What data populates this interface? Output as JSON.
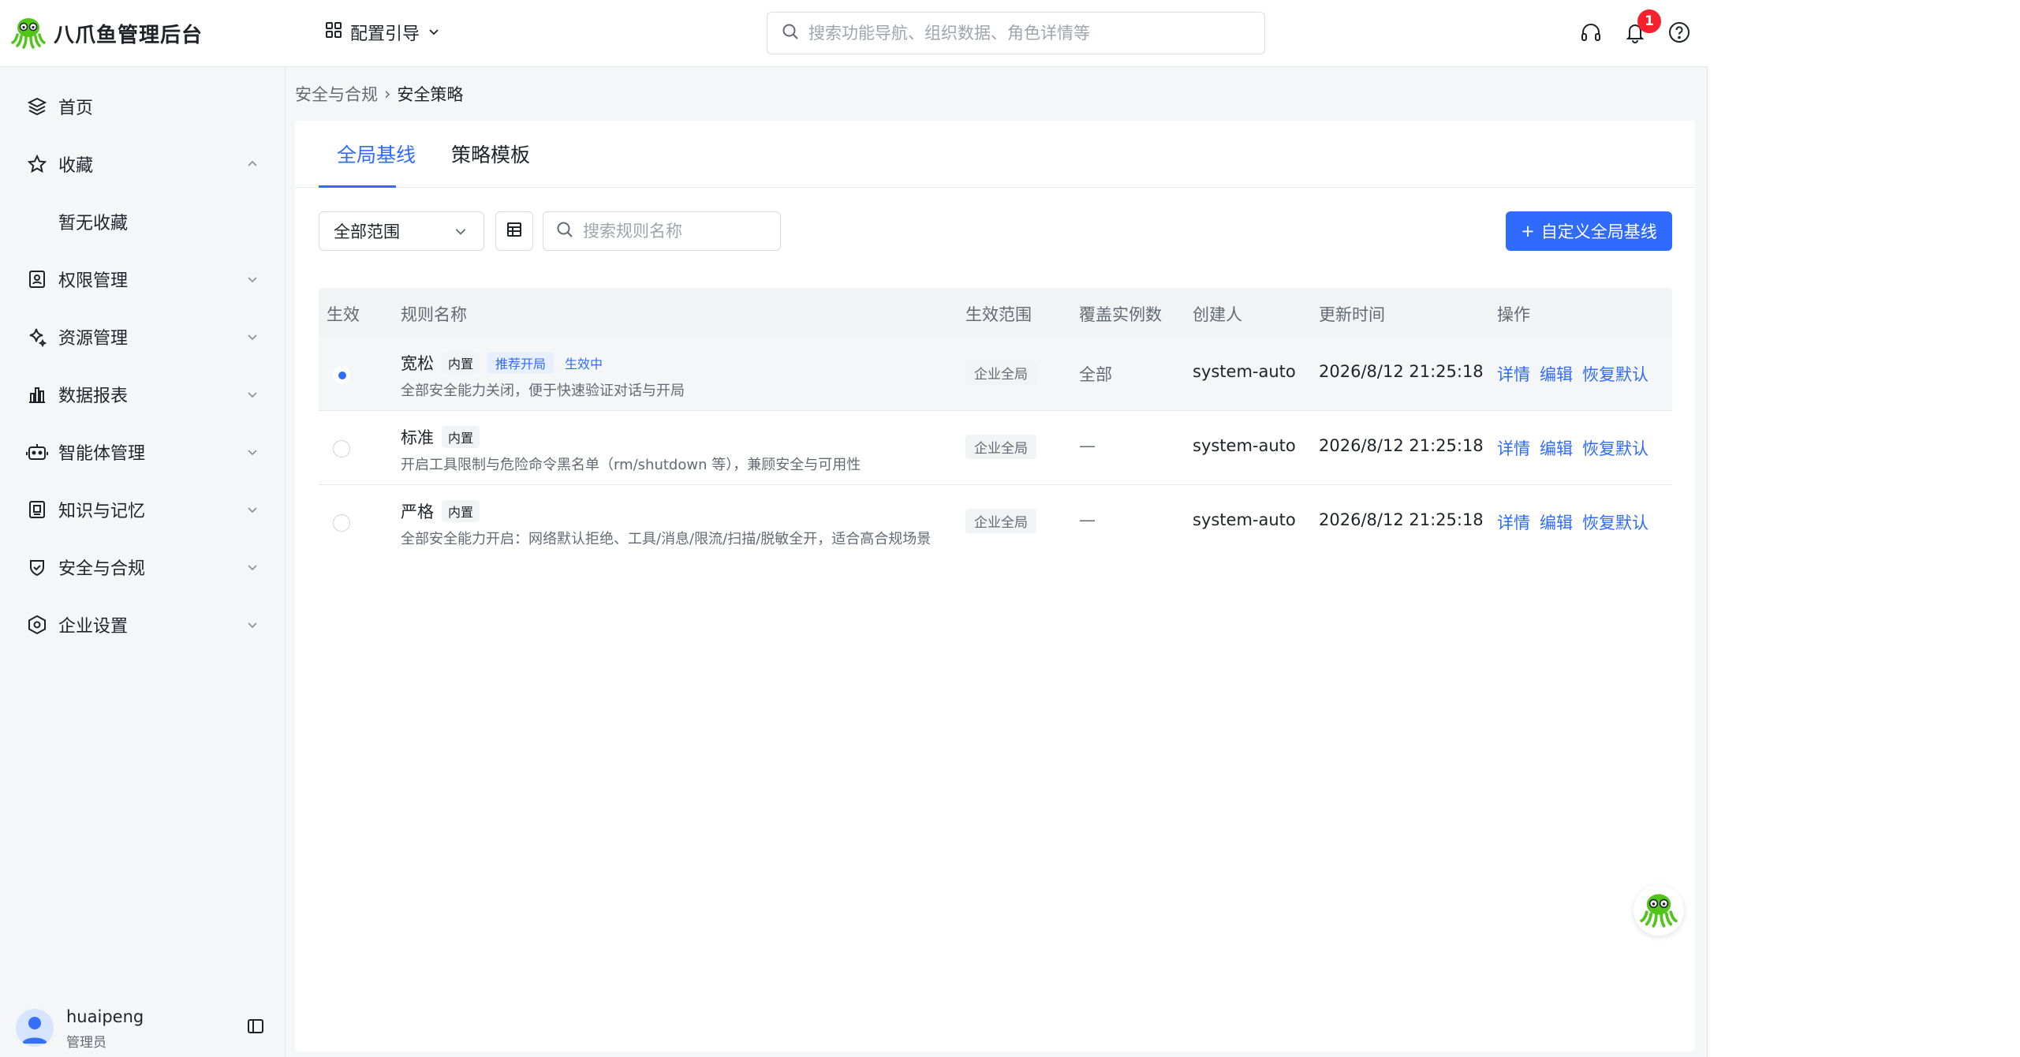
{
  "header": {
    "brand_name": "八爪鱼管理后台",
    "guide_label": "配置引导",
    "search_placeholder": "搜索功能导航、组织数据、角色详情等",
    "notification_count": "1"
  },
  "sidebar": {
    "items": [
      {
        "label": "首页",
        "icon": "layers-icon"
      },
      {
        "label": "收藏",
        "icon": "star-icon",
        "expanded": true,
        "sub": "暂无收藏"
      },
      {
        "label": "权限管理",
        "icon": "id-card-icon"
      },
      {
        "label": "资源管理",
        "icon": "sparkle-icon"
      },
      {
        "label": "数据报表",
        "icon": "bar-chart-icon"
      },
      {
        "label": "智能体管理",
        "icon": "robot-icon"
      },
      {
        "label": "知识与记忆",
        "icon": "knowledge-icon"
      },
      {
        "label": "安全与合规",
        "icon": "shield-icon"
      },
      {
        "label": "企业设置",
        "icon": "hexagon-settings-icon"
      }
    ],
    "user": {
      "name": "huaipeng",
      "role": "管理员"
    }
  },
  "breadcrumb": {
    "parent": "安全与合规",
    "separator": "›",
    "current": "安全策略"
  },
  "tabs": [
    {
      "label": "全局基线",
      "active": true
    },
    {
      "label": "策略模板",
      "active": false
    }
  ],
  "toolbar": {
    "scope_select": "全部范围",
    "rule_search_placeholder": "搜索规则名称",
    "add_button": "自定义全局基线",
    "add_button_prefix": "+"
  },
  "table": {
    "columns": [
      "生效",
      "规则名称",
      "生效范围",
      "覆盖实例数",
      "创建人",
      "更新时间",
      "操作"
    ],
    "rows": [
      {
        "selected": true,
        "name": "宽松",
        "builtin_tag": "内置",
        "recommend_tag": "推荐开局",
        "active_tag": "生效中",
        "desc": "全部安全能力关闭，便于快速验证对话与开局",
        "scope": "企业全局",
        "cover": "全部",
        "creator": "system-auto",
        "updated": "2026/8/12 21:25:18",
        "actions": [
          "详情",
          "编辑",
          "恢复默认"
        ]
      },
      {
        "selected": false,
        "name": "标准",
        "builtin_tag": "内置",
        "desc": "开启工具限制与危险命令黑名单（rm/shutdown 等），兼顾安全与可用性",
        "scope": "企业全局",
        "cover": "—",
        "creator": "system-auto",
        "updated": "2026/8/12 21:25:18",
        "actions": [
          "详情",
          "编辑",
          "恢复默认"
        ]
      },
      {
        "selected": false,
        "name": "严格",
        "builtin_tag": "内置",
        "desc": "全部安全能力开启：网络默认拒绝、工具/消息/限流/扫描/脱敏全开，适合高合规场景",
        "scope": "企业全局",
        "cover": "—",
        "creator": "system-auto",
        "updated": "2026/8/12 21:25:18",
        "actions": [
          "详情",
          "编辑",
          "恢复默认"
        ]
      }
    ]
  },
  "colors": {
    "primary": "#2f6bff",
    "badge": "#f5222d",
    "brand_green": "#52c41a"
  }
}
